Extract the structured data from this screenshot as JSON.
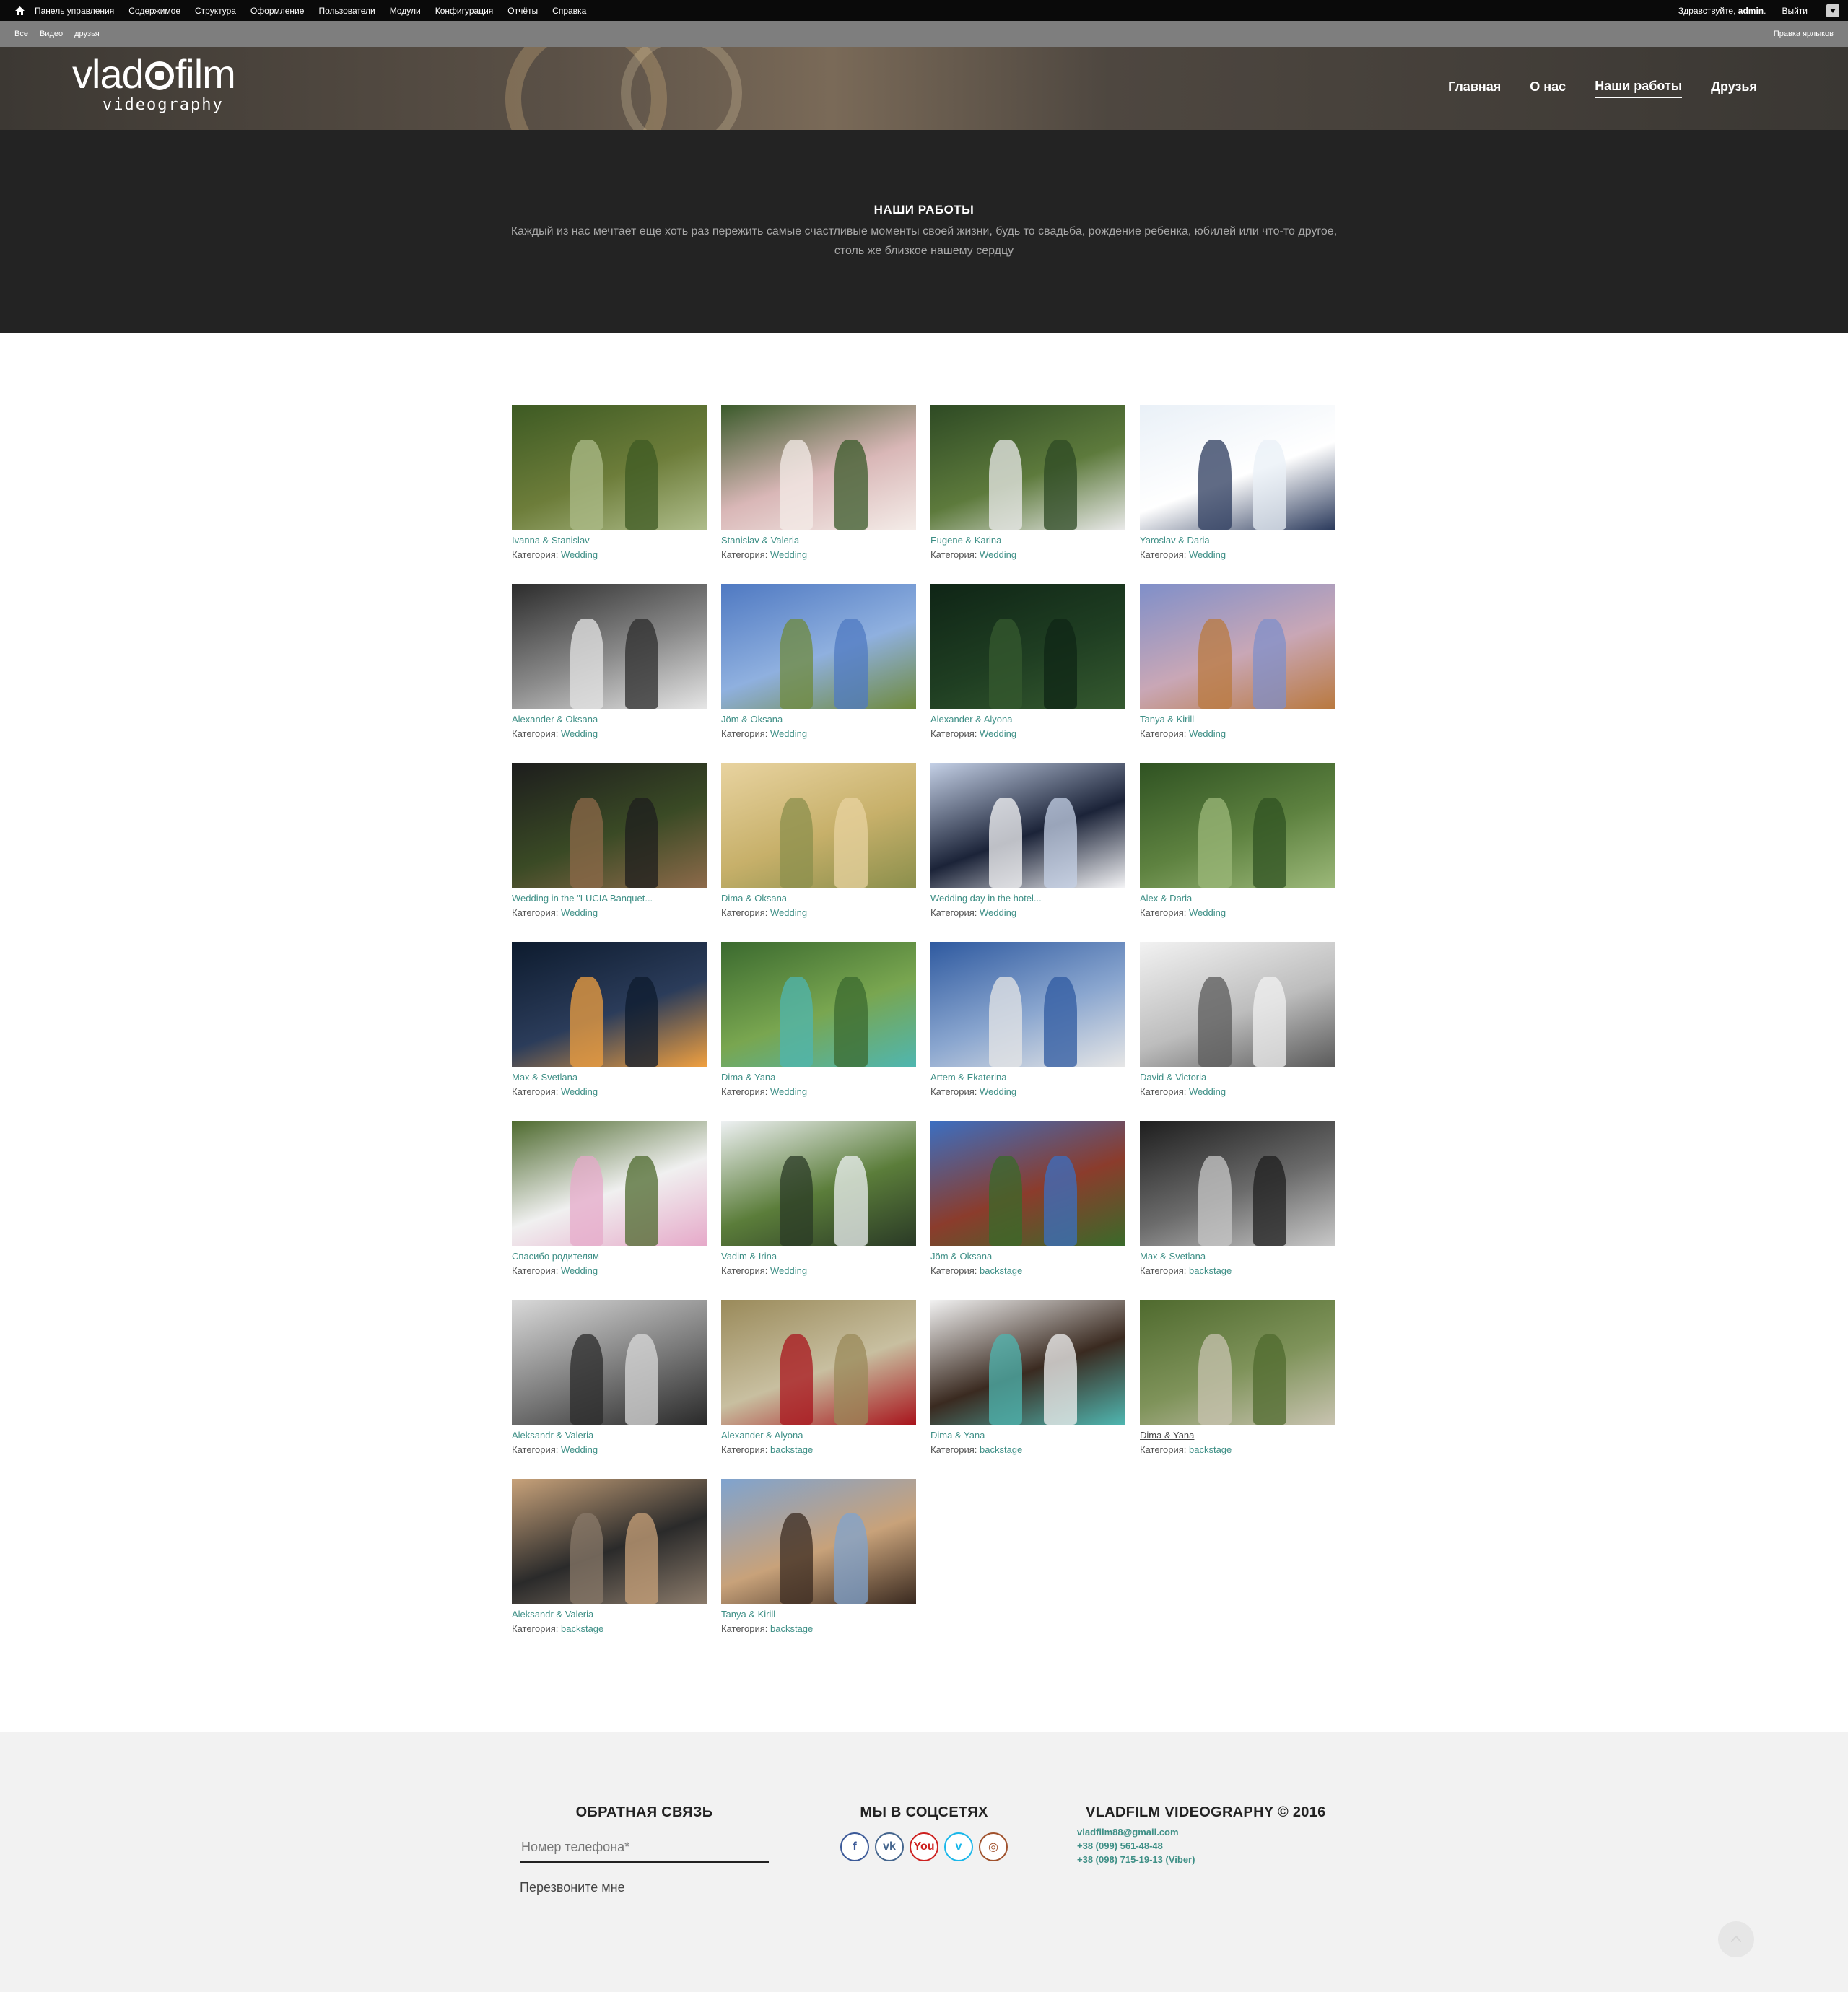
{
  "admin_bar": {
    "menu": [
      "Панель управления",
      "Содержимое",
      "Структура",
      "Оформление",
      "Пользователи",
      "Модули",
      "Конфигурация",
      "Отчёты",
      "Справка"
    ],
    "greeting": "Здравствуйте, ",
    "username": "admin",
    "greeting_end": ".",
    "logout": "Выйти"
  },
  "shortcut_bar": {
    "items": [
      "Все",
      "Видео",
      "друзья"
    ],
    "edit": "Правка ярлыков"
  },
  "header": {
    "logo_word_1": "vlad",
    "logo_word_2": "film",
    "logo_sub": "videography",
    "nav": [
      "Главная",
      "О нас",
      "Наши работы",
      "Друзья"
    ],
    "active_nav": "Наши работы"
  },
  "intro": {
    "title": "НАШИ РАБОТЫ",
    "text": "Каждый из нас мечтает еще хоть раз пережить самые счастливые моменты своей жизни, будь то свадьба, рождение ребенка, юбилей или что-то другое, столь же близкое нашему сердцу"
  },
  "gallery": {
    "category_label": "Категория: ",
    "items": [
      {
        "title": "Ivanna & Stanislav",
        "category": "Wedding",
        "colors": [
          "#3d5a23",
          "#6d7d3a",
          "#aebc8a"
        ]
      },
      {
        "title": "Stanislav & Valeria",
        "category": "Wedding",
        "colors": [
          "#3a5a2a",
          "#d9b7b7",
          "#f4ece8"
        ]
      },
      {
        "title": "Eugene & Karina",
        "category": "Wedding",
        "colors": [
          "#2e4a24",
          "#5d7a3c",
          "#e9e9e9"
        ]
      },
      {
        "title": "Yaroslav & Daria",
        "category": "Wedding",
        "colors": [
          "#e9f0f7",
          "#ffffff",
          "#2b3a5c"
        ]
      },
      {
        "title": "Alexander & Oksana",
        "category": "Wedding",
        "colors": [
          "#2c2c2c",
          "#8a8a8a",
          "#e5e5e5"
        ]
      },
      {
        "title": "Jöm & Oksana",
        "category": "Wedding",
        "colors": [
          "#4f79c2",
          "#8fb0df",
          "#6f8a3c"
        ]
      },
      {
        "title": "Alexander & Alyona",
        "category": "Wedding",
        "colors": [
          "#0f2516",
          "#1f3e22",
          "#35592f"
        ]
      },
      {
        "title": "Tanya & Kirill",
        "category": "Wedding",
        "colors": [
          "#7f8fc9",
          "#c9a7b6",
          "#b9793f"
        ]
      },
      {
        "title": "Wedding in the \"LUCIA Banquet...",
        "category": "Wedding",
        "colors": [
          "#1d1d1d",
          "#3a4a25",
          "#8d6a4a"
        ]
      },
      {
        "title": "Dima & Oksana",
        "category": "Wedding",
        "colors": [
          "#e8d3a0",
          "#c7b06a",
          "#8b8f4c"
        ]
      },
      {
        "title": "Wedding day in the hotel...",
        "category": "Wedding",
        "colors": [
          "#c4d0e6",
          "#1b2338",
          "#f4f4f6"
        ]
      },
      {
        "title": "Alex & Daria",
        "category": "Wedding",
        "colors": [
          "#2f5222",
          "#5e8240",
          "#9cb879"
        ]
      },
      {
        "title": "Max & Svetlana",
        "category": "Wedding",
        "colors": [
          "#0d1b2e",
          "#2b3c5a",
          "#f0a040"
        ]
      },
      {
        "title": "Dima & Yana",
        "category": "Wedding",
        "colors": [
          "#3b6a2f",
          "#79a650",
          "#4fb6b0"
        ]
      },
      {
        "title": "Artem & Ekaterina",
        "category": "Wedding",
        "colors": [
          "#2f5aa0",
          "#8aa6cf",
          "#e6e6e6"
        ]
      },
      {
        "title": "David & Victoria",
        "category": "Wedding",
        "colors": [
          "#f2f2f2",
          "#bdbdbd",
          "#5a5a5a"
        ]
      },
      {
        "title": "Спасибо родителям",
        "category": "Wedding",
        "colors": [
          "#4e6a2e",
          "#f0f0f0",
          "#e6a9c9"
        ]
      },
      {
        "title": "Vadim & Irina",
        "category": "Wedding",
        "colors": [
          "#eef1f3",
          "#5b7d3a",
          "#2a3a26"
        ]
      },
      {
        "title": "Jöm & Oksana",
        "category": "backstage",
        "colors": [
          "#3b6fc2",
          "#8b3c2c",
          "#3a6a2a"
        ]
      },
      {
        "title": "Max & Svetlana",
        "category": "backstage",
        "colors": [
          "#1e1e1e",
          "#6b6b6b",
          "#c8c8c8"
        ]
      },
      {
        "title": "Aleksandr & Valeria",
        "category": "Wedding",
        "colors": [
          "#d9d9d9",
          "#7a7a7a",
          "#2a2a2a"
        ]
      },
      {
        "title": "Alexander & Alyona",
        "category": "backstage",
        "colors": [
          "#9a8a5a",
          "#c8bfa0",
          "#a8141c"
        ]
      },
      {
        "title": "Dima & Yana",
        "category": "backstage",
        "colors": [
          "#f2f2f2",
          "#3a2a20",
          "#4fb6b0"
        ]
      },
      {
        "title": "Dima & Yana",
        "category": "backstage",
        "colors": [
          "#4f6a2e",
          "#7f935a",
          "#c8c3b0"
        ]
      },
      {
        "title": "Aleksandr & Valeria",
        "category": "backstage",
        "colors": [
          "#c8a27a",
          "#2a2a2a",
          "#8a7a6a"
        ]
      },
      {
        "title": "Tanya & Kirill",
        "category": "backstage",
        "colors": [
          "#7fa3cf",
          "#c8a27a",
          "#3a2a20"
        ]
      }
    ]
  },
  "footer": {
    "feedback_title": "ОБРАТНАЯ СВЯЗЬ",
    "phone_placeholder": "Номер телефона*",
    "callback": "Перезвоните мне",
    "social_title": "МЫ В СОЦСЕТЯХ",
    "social": [
      {
        "name": "facebook-icon",
        "glyph": "f",
        "color": "#3b5998"
      },
      {
        "name": "vk-icon",
        "glyph": "vk",
        "color": "#45668e"
      },
      {
        "name": "youtube-icon",
        "glyph": "You",
        "color": "#cd201f"
      },
      {
        "name": "vimeo-icon",
        "glyph": "v",
        "color": "#1ab7ea"
      },
      {
        "name": "instagram-icon",
        "glyph": "◎",
        "color": "#a0522d"
      }
    ],
    "company_title": "VLADFILM VIDEOGRAPHY © 2016",
    "email": "vladfilm88@gmail.com",
    "phone1": "+38 (099) 561-48-48",
    "phone2": "+38 (098) 715-19-13 (Viber)"
  },
  "colors": {
    "accent": "#3e8f86",
    "intro_bg": "#232323",
    "footer_bg": "#f2f2f2"
  }
}
